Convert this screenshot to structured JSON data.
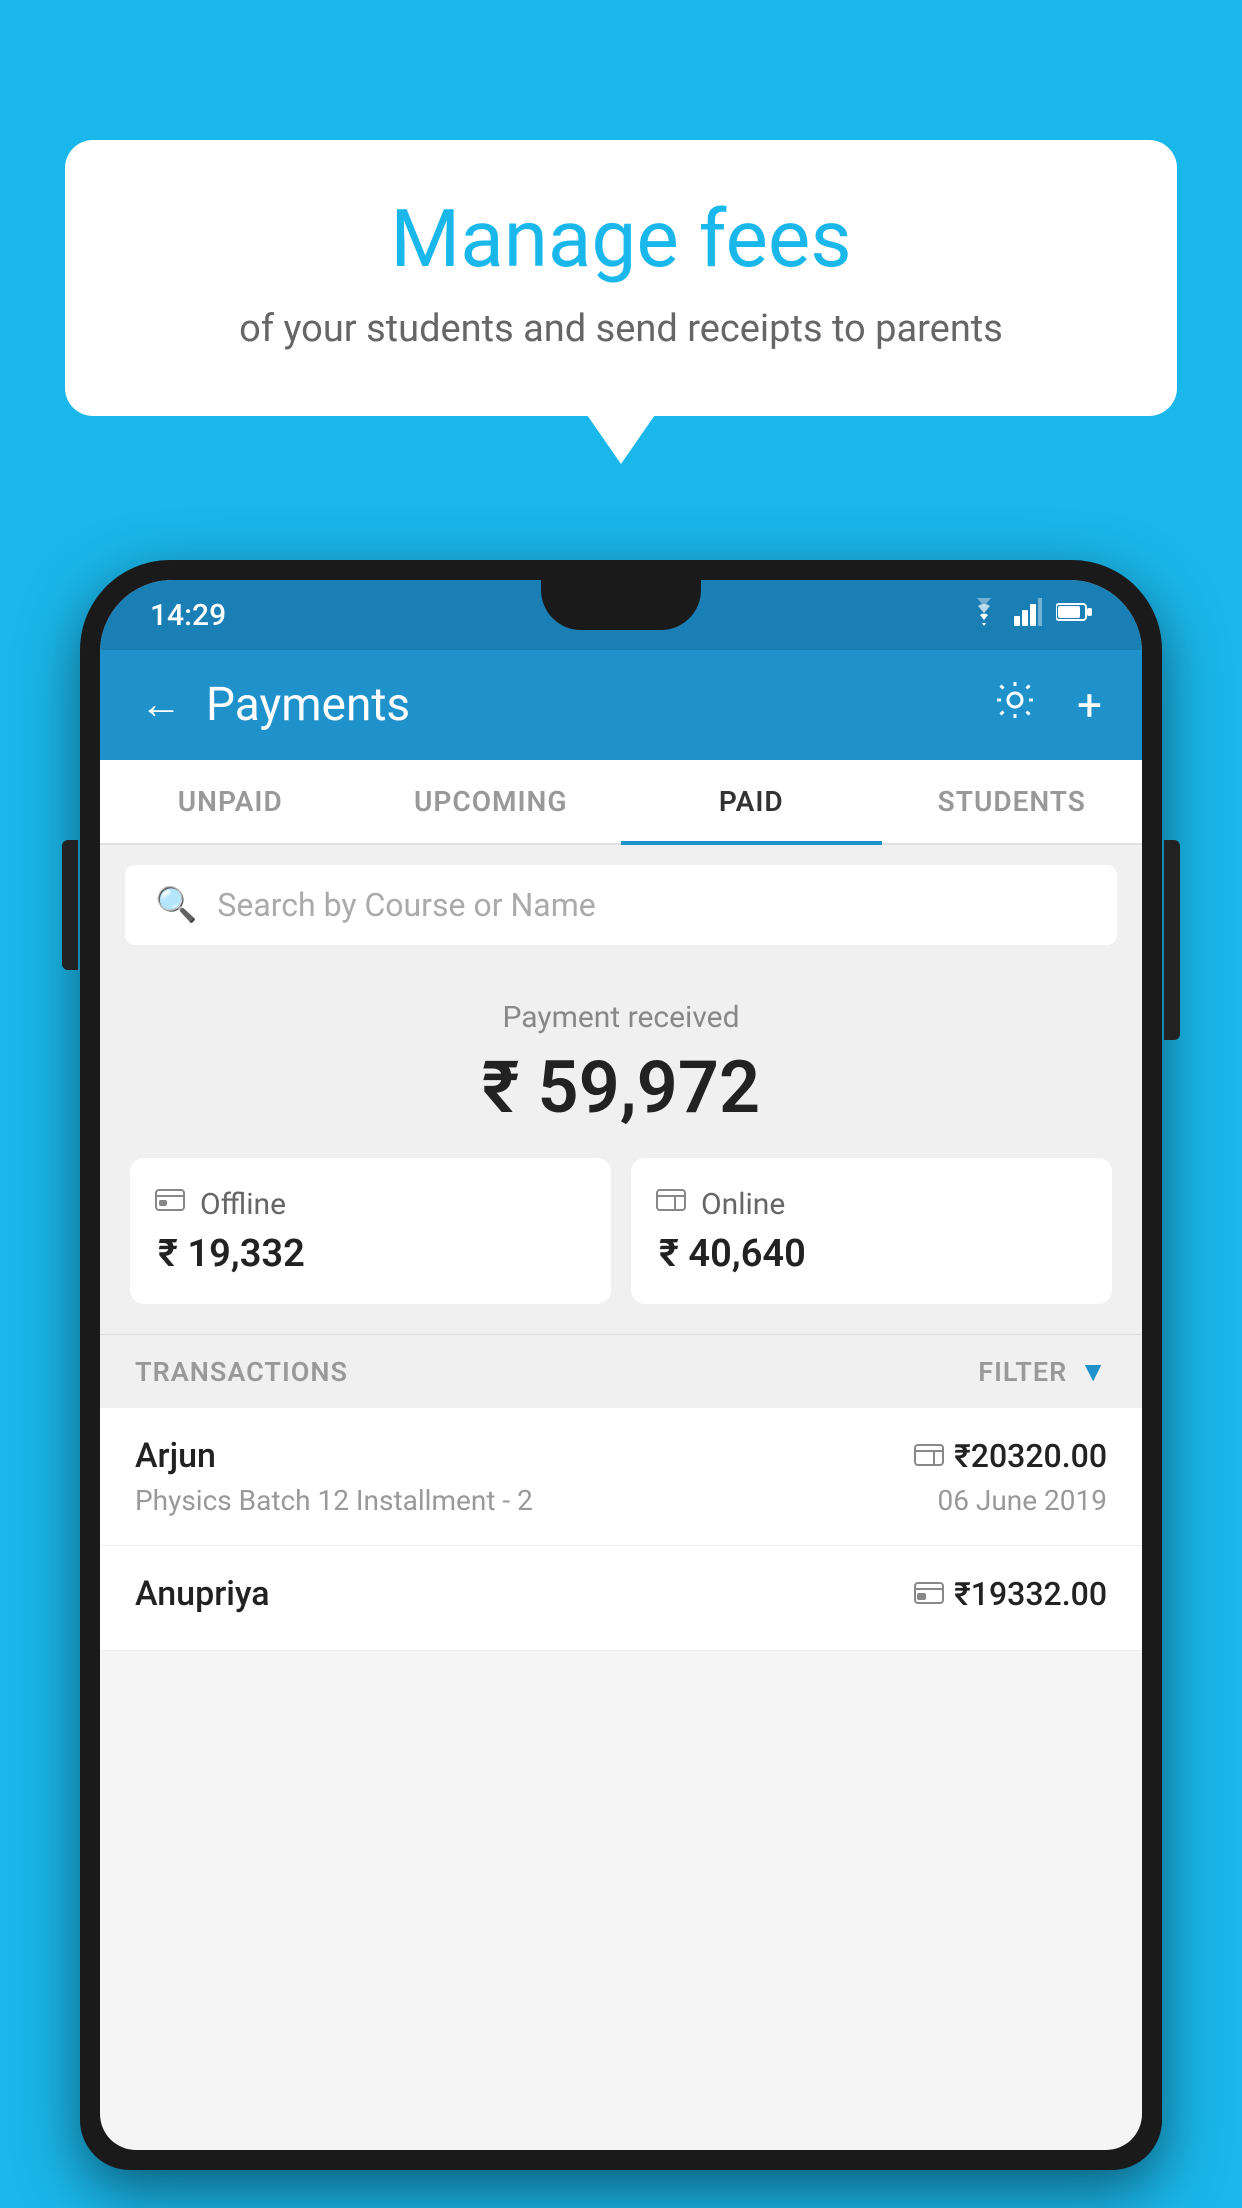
{
  "background_color": "#1ab7ea",
  "speech_bubble": {
    "title": "Manage fees",
    "subtitle": "of your students and send receipts to parents"
  },
  "status_bar": {
    "time": "14:29",
    "wifi_icon": "▼",
    "signal_icon": "▲",
    "battery_icon": "▮"
  },
  "header": {
    "title": "Payments",
    "back_label": "←",
    "settings_label": "⚙",
    "add_label": "+"
  },
  "tabs": [
    {
      "id": "unpaid",
      "label": "UNPAID",
      "active": false
    },
    {
      "id": "upcoming",
      "label": "UPCOMING",
      "active": false
    },
    {
      "id": "paid",
      "label": "PAID",
      "active": true
    },
    {
      "id": "students",
      "label": "STUDENTS",
      "active": false
    }
  ],
  "search": {
    "placeholder": "Search by Course or Name"
  },
  "payment_summary": {
    "received_label": "Payment received",
    "total_amount": "₹ 59,972",
    "offline": {
      "label": "Offline",
      "amount": "₹ 19,332"
    },
    "online": {
      "label": "Online",
      "amount": "₹ 40,640"
    }
  },
  "transactions": {
    "header_label": "TRANSACTIONS",
    "filter_label": "FILTER",
    "items": [
      {
        "name": "Arjun",
        "description": "Physics Batch 12 Installment - 2",
        "amount": "₹20320.00",
        "date": "06 June 2019",
        "type": "online"
      },
      {
        "name": "Anupriya",
        "description": "",
        "amount": "₹19332.00",
        "date": "",
        "type": "offline"
      }
    ]
  }
}
